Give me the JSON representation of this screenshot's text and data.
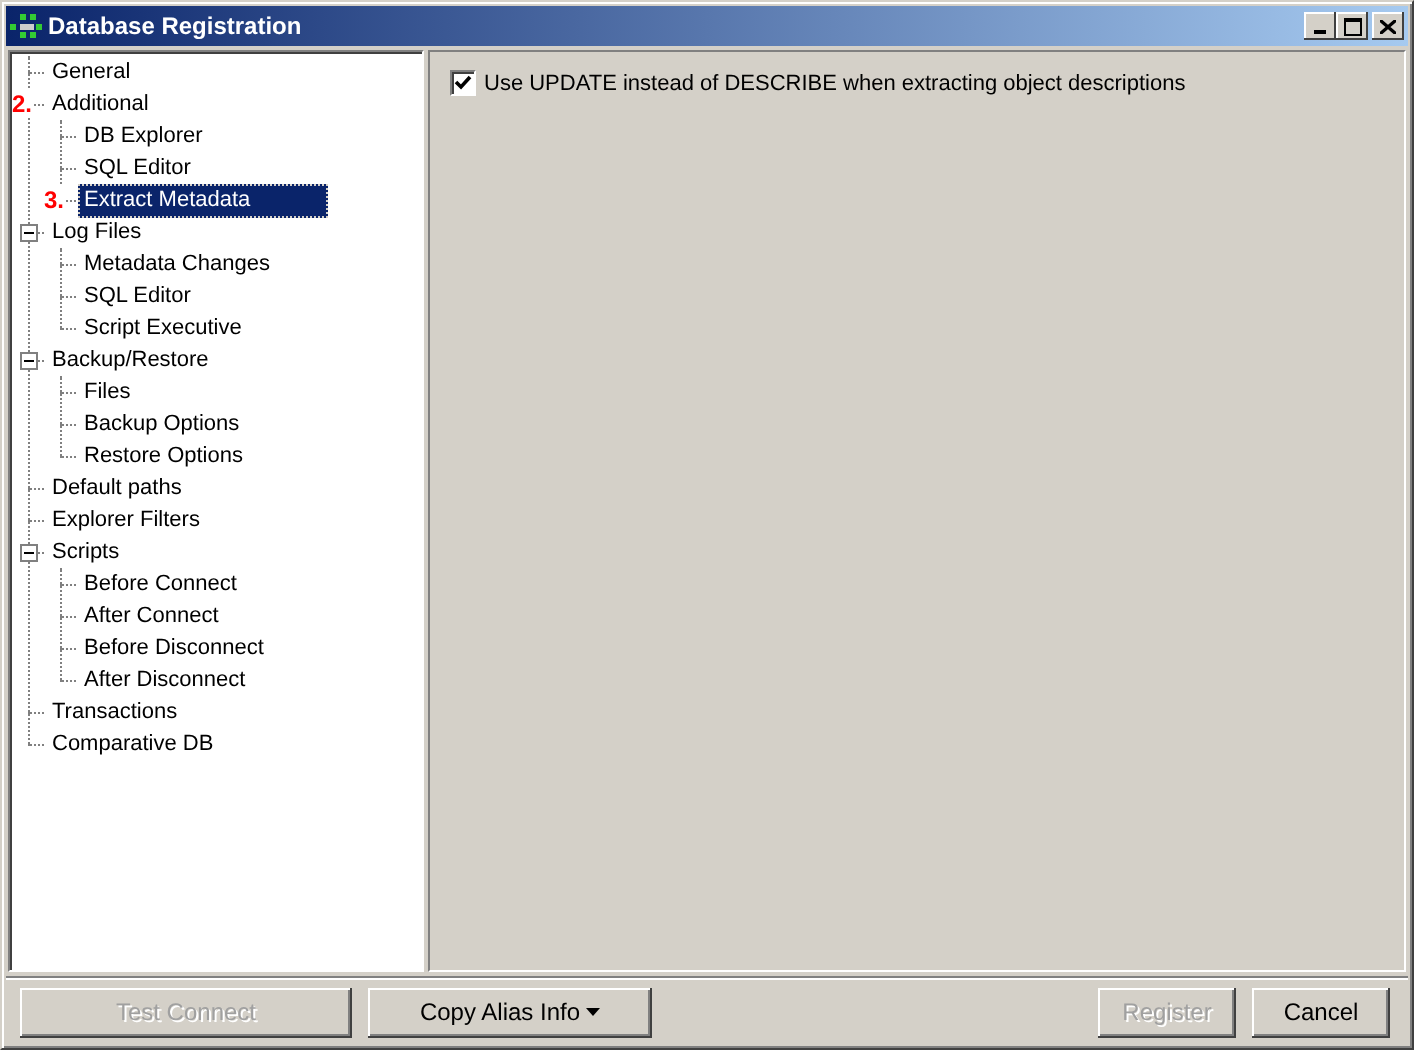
{
  "window": {
    "title": "Database Registration"
  },
  "tree": [
    {
      "label": "General",
      "selected": false
    },
    {
      "label": "Additional",
      "marker": "2.",
      "expanded": true,
      "selected": false,
      "children": [
        {
          "label": "DB Explorer",
          "selected": false
        },
        {
          "label": "SQL Editor",
          "selected": false
        },
        {
          "label": "Extract Metadata",
          "marker": "3.",
          "selected": true
        }
      ]
    },
    {
      "label": "Log Files",
      "expanded": true,
      "selected": false,
      "children": [
        {
          "label": "Metadata Changes",
          "selected": false
        },
        {
          "label": "SQL Editor",
          "selected": false
        },
        {
          "label": "Script Executive",
          "selected": false
        }
      ]
    },
    {
      "label": "Backup/Restore",
      "expanded": true,
      "selected": false,
      "children": [
        {
          "label": "Files",
          "selected": false
        },
        {
          "label": "Backup Options",
          "selected": false
        },
        {
          "label": "Restore Options",
          "selected": false
        }
      ]
    },
    {
      "label": "Default paths",
      "selected": false
    },
    {
      "label": "Explorer Filters",
      "selected": false
    },
    {
      "label": "Scripts",
      "expanded": true,
      "selected": false,
      "children": [
        {
          "label": "Before Connect",
          "selected": false
        },
        {
          "label": "After Connect",
          "selected": false
        },
        {
          "label": "Before Disconnect",
          "selected": false
        },
        {
          "label": "After Disconnect",
          "selected": false
        }
      ]
    },
    {
      "label": "Transactions",
      "selected": false
    },
    {
      "label": "Comparative DB",
      "selected": false
    }
  ],
  "options": [
    {
      "label": "Use UPDATE instead of DESCRIBE when extracting object descriptions",
      "checked": true
    }
  ],
  "buttons_left": [
    {
      "label": "Test Connect",
      "disabled": true
    },
    {
      "label": "Copy Alias Info",
      "disabled": false,
      "dropdown": true
    }
  ],
  "buttons_right": [
    {
      "label": "Register",
      "disabled": true
    },
    {
      "label": "Cancel",
      "disabled": false
    }
  ]
}
